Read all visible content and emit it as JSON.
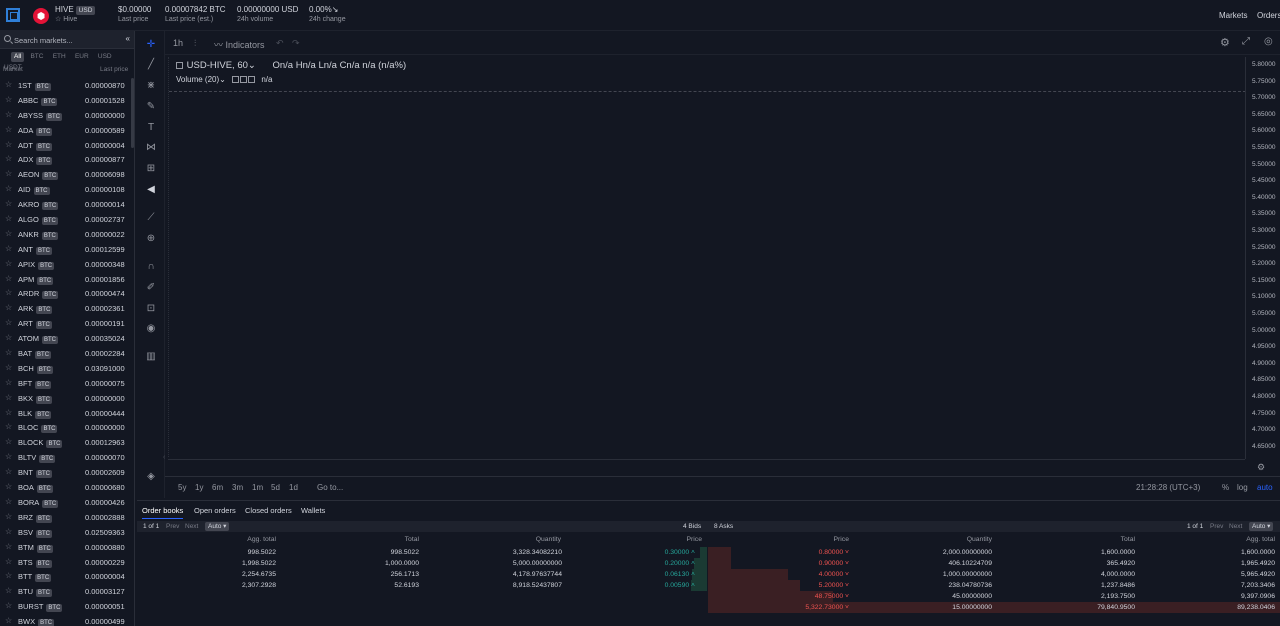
{
  "header": {
    "pair": "HIVE",
    "quote_badge": "USD",
    "pair_sub": "☆ Hive",
    "stats": [
      {
        "value": "$0.00000",
        "label": "Last price"
      },
      {
        "value": "0.00007842 BTC",
        "label": "Last price (est.)"
      },
      {
        "value": "0.00000000 USD",
        "label": "24h volume"
      },
      {
        "value": "0.00%",
        "label": "24h change"
      }
    ],
    "nav": [
      "Markets",
      "Orders"
    ]
  },
  "sidebar": {
    "search_placeholder": "Search markets...",
    "collapse_icon": "«",
    "filters": [
      "All",
      "BTC",
      "ETH",
      "EUR",
      "USD",
      "USDT"
    ],
    "col_market": "Market",
    "col_price": "Last price",
    "markets": [
      {
        "sym": "1ST",
        "q": "BTC",
        "price": "0.00000870"
      },
      {
        "sym": "ABBC",
        "q": "BTC",
        "price": "0.00001528"
      },
      {
        "sym": "ABYSS",
        "q": "BTC",
        "price": "0.00000000"
      },
      {
        "sym": "ADA",
        "q": "BTC",
        "price": "0.00000589"
      },
      {
        "sym": "ADT",
        "q": "BTC",
        "price": "0.00000004"
      },
      {
        "sym": "ADX",
        "q": "BTC",
        "price": "0.00000877"
      },
      {
        "sym": "AEON",
        "q": "BTC",
        "price": "0.00006098"
      },
      {
        "sym": "AID",
        "q": "BTC",
        "price": "0.00000108"
      },
      {
        "sym": "AKRO",
        "q": "BTC",
        "price": "0.00000014"
      },
      {
        "sym": "ALGO",
        "q": "BTC",
        "price": "0.00002737"
      },
      {
        "sym": "ANKR",
        "q": "BTC",
        "price": "0.00000022"
      },
      {
        "sym": "ANT",
        "q": "BTC",
        "price": "0.00012599"
      },
      {
        "sym": "APIX",
        "q": "BTC",
        "price": "0.00000348"
      },
      {
        "sym": "APM",
        "q": "BTC",
        "price": "0.00001856"
      },
      {
        "sym": "ARDR",
        "q": "BTC",
        "price": "0.00000474"
      },
      {
        "sym": "ARK",
        "q": "BTC",
        "price": "0.00002361"
      },
      {
        "sym": "ART",
        "q": "BTC",
        "price": "0.00000191"
      },
      {
        "sym": "ATOM",
        "q": "BTC",
        "price": "0.00035024"
      },
      {
        "sym": "BAT",
        "q": "BTC",
        "price": "0.00002284"
      },
      {
        "sym": "BCH",
        "q": "BTC",
        "price": "0.03091000"
      },
      {
        "sym": "BFT",
        "q": "BTC",
        "price": "0.00000075"
      },
      {
        "sym": "BKX",
        "q": "BTC",
        "price": "0.00000000"
      },
      {
        "sym": "BLK",
        "q": "BTC",
        "price": "0.00000444"
      },
      {
        "sym": "BLOC",
        "q": "BTC",
        "price": "0.00000000"
      },
      {
        "sym": "BLOCK",
        "q": "BTC",
        "price": "0.00012963"
      },
      {
        "sym": "BLTV",
        "q": "BTC",
        "price": "0.00000070"
      },
      {
        "sym": "BNT",
        "q": "BTC",
        "price": "0.00002609"
      },
      {
        "sym": "BOA",
        "q": "BTC",
        "price": "0.00000680"
      },
      {
        "sym": "BORA",
        "q": "BTC",
        "price": "0.00000426"
      },
      {
        "sym": "BRZ",
        "q": "BTC",
        "price": "0.00002888"
      },
      {
        "sym": "BSV",
        "q": "BTC",
        "price": "0.02509363"
      },
      {
        "sym": "BTM",
        "q": "BTC",
        "price": "0.00000880"
      },
      {
        "sym": "BTS",
        "q": "BTC",
        "price": "0.00000229"
      },
      {
        "sym": "BTT",
        "q": "BTC",
        "price": "0.00000004"
      },
      {
        "sym": "BTU",
        "q": "BTC",
        "price": "0.00003127"
      },
      {
        "sym": "BURST",
        "q": "BTC",
        "price": "0.00000051"
      },
      {
        "sym": "BWX",
        "q": "BTC",
        "price": "0.00000499"
      }
    ]
  },
  "chart": {
    "interval": "1h",
    "indicators_label": "Indicators",
    "symbol_label": "USD-HIVE, 60",
    "ohlc": "On/a  Hn/a  Ln/a  Cn/a  n/a (n/a%)",
    "volume_label": "Volume (20)",
    "volume_value": "n/a",
    "yticks": [
      "5.80000",
      "5.75000",
      "5.70000",
      "5.65000",
      "5.60000",
      "5.55000",
      "5.50000",
      "5.45000",
      "5.40000",
      "5.35000",
      "5.30000",
      "5.25000",
      "5.20000",
      "5.15000",
      "5.10000",
      "5.05000",
      "5.00000",
      "4.95000",
      "4.90000",
      "4.85000",
      "4.80000",
      "4.75000",
      "4.70000",
      "4.65000"
    ],
    "ranges": [
      "5y",
      "1y",
      "6m",
      "3m",
      "1m",
      "5d",
      "1d"
    ],
    "goto": "Go to...",
    "time": "21:28:28 (UTC+3)",
    "scale_opts": [
      "%",
      "log",
      "auto"
    ]
  },
  "panel": {
    "tabs": [
      "Order books",
      "Open orders",
      "Closed orders",
      "Wallets"
    ],
    "bids_pager": "1 of 1",
    "prev": "Prev",
    "next": "Next",
    "auto": "Auto ▾",
    "bids_count": "4 Bids",
    "asks_count": "8 Asks",
    "asks_pager": "1 of 1",
    "bid_headers": [
      "Agg. total",
      "Total",
      "Quantity",
      "Price"
    ],
    "ask_headers": [
      "Price",
      "Quantity",
      "Total",
      "Agg. total"
    ],
    "bids": [
      {
        "agg": "998.5022",
        "total": "998.5022",
        "qty": "3,328.34082210",
        "price": "0.30000",
        "depth": 0.11
      },
      {
        "agg": "1,998.5022",
        "total": "1,000.0000",
        "qty": "5,000.00000000",
        "price": "0.20000",
        "depth": 0.22
      },
      {
        "agg": "2,254.6735",
        "total": "256.1713",
        "qty": "4,178.97637744",
        "price": "0.06130",
        "depth": 0.25
      },
      {
        "agg": "2,307.2928",
        "total": "52.6193",
        "qty": "8,918.52437807",
        "price": "0.00590",
        "depth": 0.26
      }
    ],
    "asks": [
      {
        "price": "0.80000",
        "qty": "2,000.00000000",
        "total": "1,600.0000",
        "agg": "1,600.0000",
        "depth": 0.02
      },
      {
        "price": "0.90000",
        "qty": "406.10224709",
        "total": "365.4920",
        "agg": "1,965.4920",
        "depth": 0.02
      },
      {
        "price": "4.00000",
        "qty": "1,000.00000000",
        "total": "4,000.0000",
        "agg": "5,965.4920",
        "depth": 0.07
      },
      {
        "price": "5.20000",
        "qty": "238.04780736",
        "total": "1,237.8486",
        "agg": "7,203.3406",
        "depth": 0.08
      },
      {
        "price": "48.75000",
        "qty": "45.00000000",
        "total": "2,193.7500",
        "agg": "9,397.0906",
        "depth": 0.11
      },
      {
        "price": "5,322.73000",
        "qty": "15.00000000",
        "total": "79,840.9500",
        "agg": "89,238.0406",
        "depth": 1.0
      }
    ]
  },
  "colors": {
    "accent": "#2962ff",
    "bid": "#26a69a",
    "ask": "#ef5350",
    "bg": "#131722"
  }
}
